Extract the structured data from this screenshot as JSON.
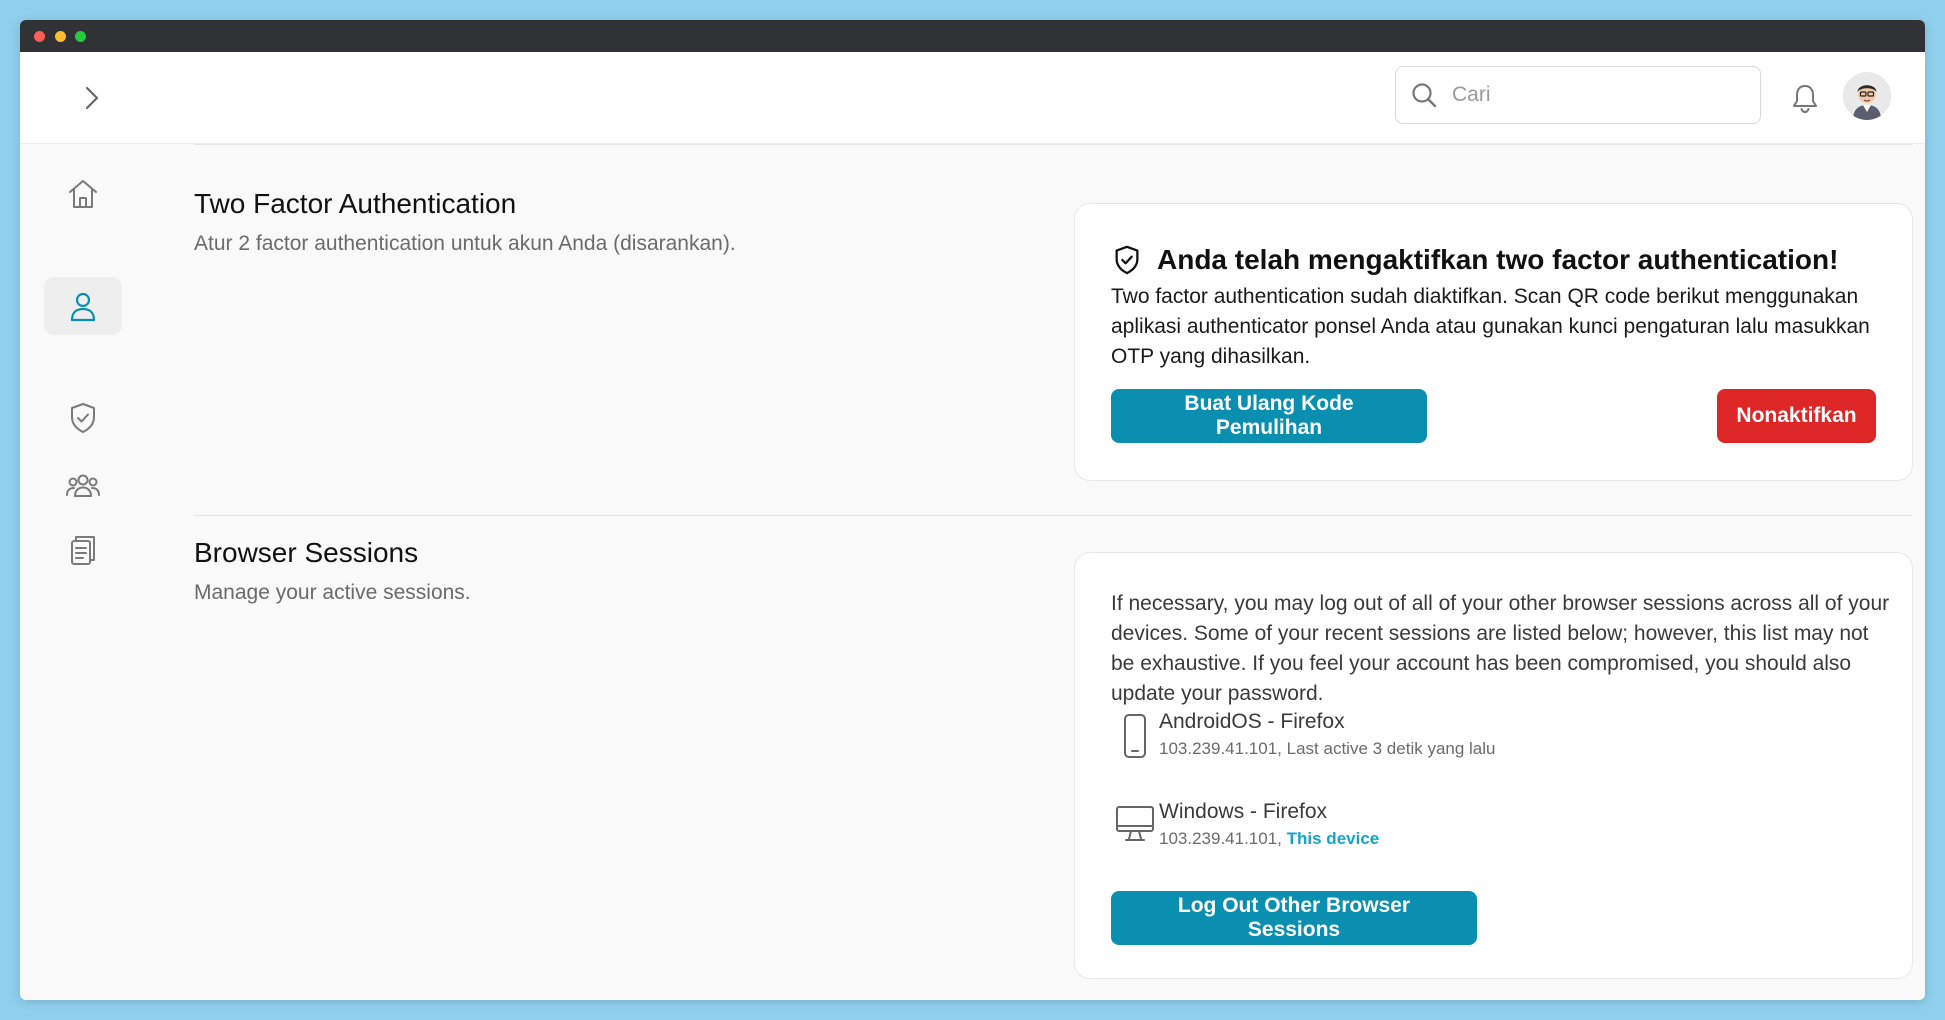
{
  "header": {
    "search": {
      "placeholder": "Cari"
    },
    "icons": {
      "expand": "chevron-right-icon",
      "search": "search-icon",
      "notifications": "bell-icon",
      "avatar": "user-avatar"
    }
  },
  "sidebar": {
    "items": [
      {
        "name": "home",
        "icon": "home-icon",
        "active": false
      },
      {
        "name": "profile",
        "icon": "user-icon",
        "active": true
      },
      {
        "name": "security",
        "icon": "shield-check-icon",
        "active": false
      },
      {
        "name": "team",
        "icon": "users-group-icon",
        "active": false
      },
      {
        "name": "clipboard",
        "icon": "clipboard-list-icon",
        "active": false
      }
    ]
  },
  "two_factor": {
    "title": "Two Factor Authentication",
    "description": "Atur 2 factor authentication untuk akun Anda (disarankan).",
    "status_heading": "Anda telah mengaktifkan two factor authentication!",
    "status_body": "Two factor authentication sudah diaktifkan. Scan QR code berikut menggunakan aplikasi authenticator ponsel Anda atau gunakan kunci pengaturan lalu masukkan OTP yang dihasilkan.",
    "regenerate_label": "Buat Ulang Kode Pemulihan",
    "disable_label": "Nonaktifkan"
  },
  "browser_sessions": {
    "title": "Browser Sessions",
    "description": "Manage your active sessions.",
    "info": "If necessary, you may log out of all of your other browser sessions across all of your devices. Some of your recent sessions are listed below; however, this list may not be exhaustive. If you feel your account has been compromised, you should also update your password.",
    "sessions": [
      {
        "device": "AndroidOS - Firefox",
        "ip": "103.239.41.101,",
        "status": "Last active 3 detik yang lalu",
        "icon": "mobile-phone-icon"
      },
      {
        "device": "Windows - Firefox",
        "ip": "103.239.41.101,",
        "status": "This device",
        "icon": "desktop-icon"
      }
    ],
    "logout_label": "Log Out Other Browser Sessions"
  },
  "colors": {
    "accent": "#0b8fb0",
    "danger": "#dd2727",
    "this_device": "#14a6c9"
  }
}
